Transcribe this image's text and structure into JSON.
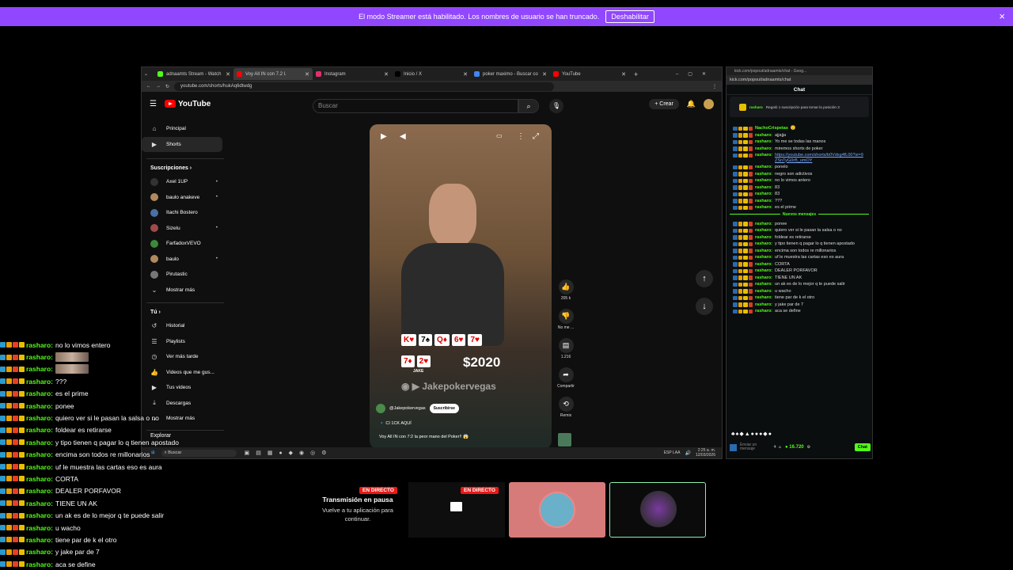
{
  "banner": {
    "message": "El modo Streamer está habilitado. Los nombres de usuario se han truncado.",
    "button": "Deshabilitar",
    "close": "×"
  },
  "browser": {
    "tabs": [
      {
        "label": "adnaamts Stream - Watch",
        "color": "#53fc18",
        "active": false
      },
      {
        "label": "Voy All IN con 7.2 l.",
        "color": "#ff0000",
        "active": true
      },
      {
        "label": "Instagram",
        "color": "#e1306c",
        "active": false
      },
      {
        "label": "Inicio / X",
        "color": "#000000",
        "active": false
      },
      {
        "label": "poker maximo - Buscar co",
        "color": "#4285f4",
        "active": false
      },
      {
        "label": "YouTube",
        "color": "#ff0000",
        "active": false
      }
    ],
    "url": "youtube.com/shorts/hukAq6dtwdg"
  },
  "youtube": {
    "logo": "YouTube",
    "search_placeholder": "Buscar",
    "create": "Crear",
    "sidebar_main": [
      {
        "label": "Principal",
        "icon": "home-icon"
      },
      {
        "label": "Shorts",
        "icon": "shorts-icon"
      }
    ],
    "subs_heading": "Suscripciones",
    "subscriptions": [
      {
        "label": "Axel 1UP",
        "color": "#333333",
        "dot": true
      },
      {
        "label": "baulo anakeve",
        "color": "#b08a5e",
        "dot": true
      },
      {
        "label": "Itachi Bostero",
        "color": "#4a6fa5",
        "dot": false
      },
      {
        "label": "Sizelu",
        "color": "#a04a4a",
        "dot": true
      },
      {
        "label": "FarfadoxVEVO",
        "color": "#3a8a3a",
        "dot": false
      },
      {
        "label": "baulo",
        "color": "#b08a5e",
        "dot": true
      },
      {
        "label": "Pirutastic",
        "color": "#777777",
        "dot": false
      },
      {
        "label": "Mostrar más",
        "color": "",
        "dot": false
      }
    ],
    "you_heading": "Tú",
    "you_items": [
      {
        "label": "Historial",
        "icon": "history-icon"
      },
      {
        "label": "Playlists",
        "icon": "playlist-icon"
      },
      {
        "label": "Ver más tarde",
        "icon": "clock-icon"
      },
      {
        "label": "Videos que me gus...",
        "icon": "like-icon"
      },
      {
        "label": "Tus videos",
        "icon": "video-icon"
      },
      {
        "label": "Descargas",
        "icon": "download-icon"
      },
      {
        "label": "Mostrar más",
        "icon": "chevron-down-icon"
      }
    ],
    "explore": "Explorar",
    "short": {
      "board_cards": [
        "K♥",
        "7♠",
        "Q♦",
        "6♥",
        "7♥"
      ],
      "hand_cards": [
        "7♦",
        "2♥"
      ],
      "player": "JAKE",
      "prize": "$2020",
      "watermark": "Jakepokervegas",
      "channel": "@Jakepokervegas",
      "subscribe": "Suscribirse",
      "caption1": "🔹 CI 1CK AQUÍ",
      "caption2": "Voy All IN con 7:2 la peor mano del Poker!! 😱"
    },
    "actions": [
      {
        "icon": "thumbs-up-icon",
        "label": "205 k"
      },
      {
        "icon": "thumbs-down-icon",
        "label": "No me ..."
      },
      {
        "icon": "comment-icon",
        "label": "1.216"
      },
      {
        "icon": "share-icon",
        "label": "Compartir"
      },
      {
        "icon": "remix-icon",
        "label": "Remix"
      }
    ]
  },
  "taskbar": {
    "search": "Buscar",
    "lang": "ESP LAA",
    "time": "2:25 a. m.",
    "date": "12/03/2026"
  },
  "kick": {
    "tab_title": "kick.com/popout/adnaamts/chat - Goog...",
    "url": "kick.com/popout/adnaamts/chat",
    "header": "Chat",
    "pinned_user": "rasharo",
    "pinned_text": "Regaló 1 suscripción para tomar la posición 3",
    "messages_top": [
      {
        "user": "NachoCrispetas",
        "text": "🙂",
        "color": "#53fc18"
      },
      {
        "user": "rasharo:",
        "text": "ajjajja"
      },
      {
        "user": "rasharo:",
        "text": "Yo me se todas las manos"
      },
      {
        "user": "rasharo:",
        "text": "miremos shorts de poker"
      },
      {
        "user": "rasharo:",
        "text": "https://youtube.com/shorts/b0Vdxg4fL00?si=9ZSnTyG0rB_umOY",
        "link": true
      },
      {
        "user": "rasharo:",
        "text": "ponelo"
      },
      {
        "user": "rasharo:",
        "text": "negro son adictivos"
      },
      {
        "user": "rasharo:",
        "text": "no lo vimos antero"
      },
      {
        "user": "rasharo:",
        "text": "83"
      },
      {
        "user": "rasharo:",
        "text": "83"
      },
      {
        "user": "rasharo:",
        "text": "???"
      },
      {
        "user": "rasharo:",
        "text": "es el prime"
      }
    ],
    "new_messages_label": "Nuevos mensajes",
    "messages_bottom": [
      {
        "user": "rasharo:",
        "text": "ponee"
      },
      {
        "user": "rasharo:",
        "text": "quiero ver si le pasan la salsa o no"
      },
      {
        "user": "rasharo:",
        "text": "foldear es retirarse"
      },
      {
        "user": "rasharo:",
        "text": "y tipo tienen q pagar lo q tienen apostado"
      },
      {
        "user": "rasharo:",
        "text": "encima son todos re millonarios"
      },
      {
        "user": "rasharo:",
        "text": "uf le muestra las cartas eso es aura"
      },
      {
        "user": "rasharo:",
        "text": "CORTA"
      },
      {
        "user": "rasharo:",
        "text": "DEALER PORFAVOR"
      },
      {
        "user": "rasharo:",
        "text": "TIENE UN AK"
      },
      {
        "user": "rasharo:",
        "text": "un ak es de lo mejor q te puede salir"
      },
      {
        "user": "rasharo:",
        "text": "u wacho"
      },
      {
        "user": "rasharo:",
        "text": "tiene par de k el otro"
      },
      {
        "user": "rasharo:",
        "text": "y jake par de 7"
      },
      {
        "user": "rasharo:",
        "text": "aca se define"
      }
    ],
    "input_placeholder": "Enviar un mensaje",
    "points": "16.720",
    "chat_button": "Chat"
  },
  "overlay_chat": [
    {
      "user": "rasharo:",
      "text": "no lo vimos entero"
    },
    {
      "user": "rasharo:",
      "text": "",
      "emote": true
    },
    {
      "user": "rasharo:",
      "text": "",
      "emote": true
    },
    {
      "user": "rasharo:",
      "text": "???"
    },
    {
      "user": "rasharo:",
      "text": "es el prime"
    },
    {
      "user": "rasharo:",
      "text": "ponee"
    },
    {
      "user": "rasharo:",
      "text": "quiero ver si le pasan la salsa o no"
    },
    {
      "user": "rasharo:",
      "text": "foldear es retirarse"
    },
    {
      "user": "rasharo:",
      "text": "y tipo tienen q pagar lo q tienen apostado"
    },
    {
      "user": "rasharo:",
      "text": "encima son todos re millonarios"
    },
    {
      "user": "rasharo:",
      "text": "uf le muestra las cartas eso es aura"
    },
    {
      "user": "rasharo:",
      "text": "CORTA"
    },
    {
      "user": "rasharo:",
      "text": "DEALER PORFAVOR"
    },
    {
      "user": "rasharo:",
      "text": "TIENE UN AK"
    },
    {
      "user": "rasharo:",
      "text": "un ak es de lo mejor q te puede salir"
    },
    {
      "user": "rasharo:",
      "text": "u wacho"
    },
    {
      "user": "rasharo:",
      "text": "tiene par de k el otro"
    },
    {
      "user": "rasharo:",
      "text": "y jake par de 7"
    },
    {
      "user": "rasharo:",
      "text": "aca se define"
    }
  ],
  "stream": {
    "live1": "EN DIRECTO",
    "live2": "EN DIRECTO",
    "paused_title": "Transmisión en pausa",
    "paused_text": "Vuelve a tu aplicación para continuar."
  },
  "colors": {
    "kick_green": "#53fc18",
    "streamer_purple": "#9147ff",
    "live_red": "#e91916"
  }
}
